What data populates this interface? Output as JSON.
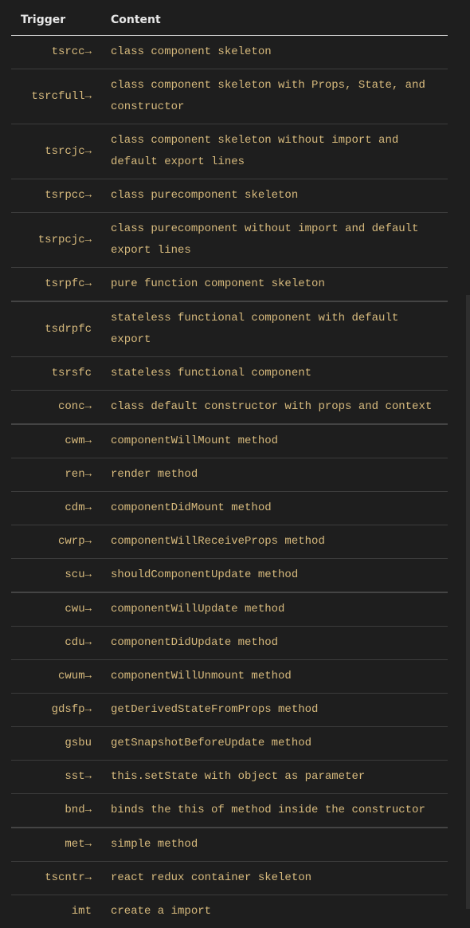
{
  "headers": {
    "trigger": "Trigger",
    "content": "Content"
  },
  "rows": [
    {
      "trigger": "tsrcc→",
      "content": "class component skeleton"
    },
    {
      "trigger": "tsrcfull→",
      "content": "class component skeleton with Props, State, and constructor"
    },
    {
      "trigger": "tsrcjc→",
      "content": "class component skeleton without import and default export lines"
    },
    {
      "trigger": "tsrpcc→",
      "content": "class purecomponent skeleton"
    },
    {
      "trigger": "tsrpcjc→",
      "content": "class purecomponent without import and default export lines"
    },
    {
      "trigger": "tsrpfc→",
      "content": "pure function component skeleton"
    },
    {
      "trigger": "tsdrpfc",
      "content": "stateless functional component with default export"
    },
    {
      "trigger": "tsrsfc",
      "content": "stateless functional component"
    },
    {
      "trigger": "conc→",
      "content": "class default constructor with props and context"
    },
    {
      "trigger": "cwm→",
      "content": "componentWillMount method"
    },
    {
      "trigger": "ren→",
      "content": "render method"
    },
    {
      "trigger": "cdm→",
      "content": "componentDidMount method"
    },
    {
      "trigger": "cwrp→",
      "content": "componentWillReceiveProps method"
    },
    {
      "trigger": "scu→",
      "content": "shouldComponentUpdate method"
    },
    {
      "trigger": "cwu→",
      "content": "componentWillUpdate method"
    },
    {
      "trigger": "cdu→",
      "content": "componentDidUpdate method"
    },
    {
      "trigger": "cwum→",
      "content": "componentWillUnmount method"
    },
    {
      "trigger": "gdsfp→",
      "content": "getDerivedStateFromProps method"
    },
    {
      "trigger": "gsbu",
      "content": "getSnapshotBeforeUpdate method"
    },
    {
      "trigger": "sst→",
      "content": "this.setState with object as parameter"
    },
    {
      "trigger": "bnd→",
      "content": "binds the this of method inside the constructor"
    },
    {
      "trigger": "met→",
      "content": "simple method"
    },
    {
      "trigger": "tscntr→",
      "content": "react redux container skeleton"
    },
    {
      "trigger": "imt",
      "content": "create a import"
    }
  ]
}
